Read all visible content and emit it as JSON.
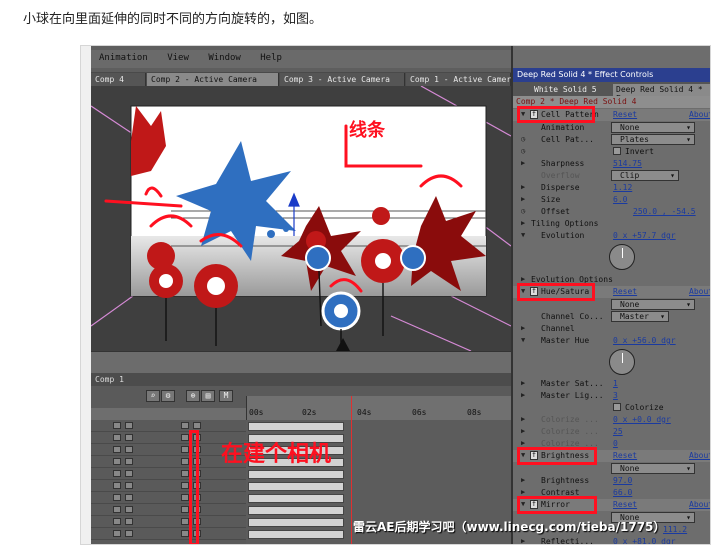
{
  "caption": "小球在向里面延伸的同时不同的方向旋转的，如图。",
  "menu": [
    "Animation",
    "View",
    "Window",
    "Help"
  ],
  "comp_tabs": [
    "Comp 4",
    "Comp 2 - Active Camera",
    "Comp 3 - Active Camera",
    "Comp 1 - Active Camer"
  ],
  "timeline": {
    "tab": "Comp 1",
    "ruler_ticks": [
      "00s",
      "02s",
      "04s",
      "06s",
      "08s"
    ],
    "tool_label": "M"
  },
  "annotations": {
    "line": "线条",
    "camera": "在建个相机"
  },
  "effects_panel": {
    "title": "Deep Red Solid 4 * Effect Controls",
    "tabs": [
      "White Solid 5",
      "Deep Red Solid 4 * E"
    ],
    "subtitle": "Comp 2 * Deep Red Solid 4",
    "reset_label": "Reset",
    "about_label": "About",
    "cell_pattern": {
      "name": "Cell Pattern",
      "animation_label": "Animation",
      "animation_value": "None",
      "cell_pattern_label": "Cell Pat...",
      "cell_pattern_value": "Plates",
      "invert_label": "Invert",
      "overflow_label": "Overflow",
      "overflow_value": "Clip",
      "sharpness_label": "Sharpness",
      "sharpness_value": "514.75",
      "disperse_label": "Disperse",
      "disperse_value": "1.12",
      "size_label": "Size",
      "size_value": "6.0",
      "offset_label": "Offset",
      "offset_value": "250.0 , -54.5",
      "tiling_label": "Tiling Options",
      "evolution_label": "Evolution",
      "evolution_value": "0 x +57.7 dgr",
      "evolution_options_label": "Evolution Options"
    },
    "hue_saturation": {
      "name": "Hue/Satura",
      "animation_value": "None",
      "channel_control_label": "Channel Co...",
      "channel_control_value": "Master",
      "channel_range_label": "Channel",
      "master_hue_label": "Master Hue",
      "master_hue_value": "0 x +56.0 dgr",
      "master_sat_label": "Master Sat...",
      "master_sat_value": "1",
      "master_light_label": "Master Lig...",
      "master_light_value": "3",
      "colorize_label": "Colorize",
      "colorize_hue_label": "Colorize ...",
      "colorize_hue_value": "0 x +0.0 dgr",
      "colorize_sat_label": "Colorize ...",
      "colorize_sat_value": "25",
      "colorize_light_label": "Colorize ...",
      "colorize_light_value": "0"
    },
    "brightness": {
      "name": "Brightness",
      "animation_value": "None",
      "brightness_label": "Brightness",
      "brightness_value": "97.0",
      "contrast_label": "Contrast",
      "contrast_value": "66.0"
    },
    "mirror": {
      "name": "Mirror",
      "animation_value": "None",
      "value": "111.2",
      "reflection_label": "Reflecti...",
      "reflection_value": "0 x +81.0 dgr"
    }
  },
  "watermark": "雷云AE后期学习吧（www.linecg.com/tieba/1775）",
  "colors": {
    "annotation_red": "#ff1020",
    "title_bar_blue": "#2b3f8f",
    "link_blue": "#1a3aa0",
    "ball_red": "#c01818",
    "ball_blue": "#2f6fc0"
  }
}
